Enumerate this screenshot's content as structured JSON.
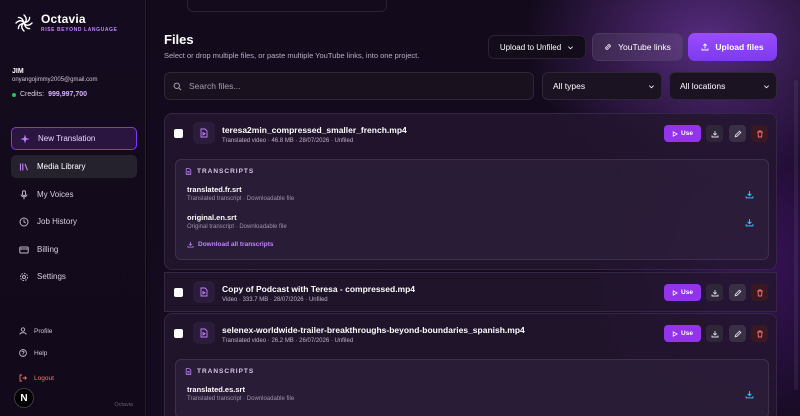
{
  "brand": {
    "name": "Octavia",
    "tagline": "RISE BEYOND LANGUAGE"
  },
  "user": {
    "name": "JIM",
    "email": "onyangojimmy2005@gmail.com",
    "credits_label": "Credits:",
    "credits_value": "999,997,700"
  },
  "nav": {
    "new_translation": "New Translation",
    "media_library": "Media Library",
    "my_voices": "My Voices",
    "job_history": "Job History",
    "billing": "Billing",
    "settings": "Settings"
  },
  "bottom_nav": {
    "profile": "Profile",
    "help": "Help",
    "logout": "Logout"
  },
  "sidebar_footer": "Octavia",
  "n_badge": "N",
  "page": {
    "title": "Files",
    "subtitle": "Select or drop multiple files, or paste multiple YouTube links, into one project."
  },
  "toolbar": {
    "upload_target": "Upload to Unfiled",
    "youtube_links": "YouTube links",
    "upload_files": "Upload files"
  },
  "search": {
    "placeholder": "Search files..."
  },
  "filters": {
    "types": "All types",
    "locations": "All locations"
  },
  "files": [
    {
      "title": "teresa2min_compressed_smaller_french.mp4",
      "meta": "Translated video · 46.8 MB · 28/07/2026 · Unfiled",
      "use_label": "Use",
      "transcripts_header": "TRANSCRIPTS",
      "transcripts": [
        {
          "name": "translated.fr.srt",
          "desc": "Translated transcript · Downloadable file"
        },
        {
          "name": "original.en.srt",
          "desc": "Original transcript · Downloadable file"
        }
      ],
      "download_all": "Download all transcripts"
    },
    {
      "title": "Copy of Podcast with Teresa - compressed.mp4",
      "meta": "Video · 333.7 MB · 28/07/2026 · Unfiled",
      "use_label": "Use"
    },
    {
      "title": "selenex-worldwide-trailer-breakthroughs-beyond-boundaries_spanish.mp4",
      "meta": "Translated video · 26.2 MB · 26/07/2026 · Unfiled",
      "use_label": "Use",
      "transcripts_header": "TRANSCRIPTS",
      "transcripts": [
        {
          "name": "translated.es.srt",
          "desc": "Translated transcript · Downloadable file"
        }
      ]
    }
  ],
  "colors": {
    "accent": "#9333ea",
    "accent_light": "#c084fc",
    "success": "#22c55e",
    "danger": "#f87171"
  },
  "icons": {
    "brand": "octavia-swirl-logo",
    "new_translation": "sparkle-icon",
    "media_library": "library-icon",
    "my_voices": "microphone-icon",
    "job_history": "clock-icon",
    "billing": "credit-card-icon",
    "settings": "gear-icon",
    "profile": "user-icon",
    "help": "help-circle-icon",
    "logout": "logout-icon"
  }
}
